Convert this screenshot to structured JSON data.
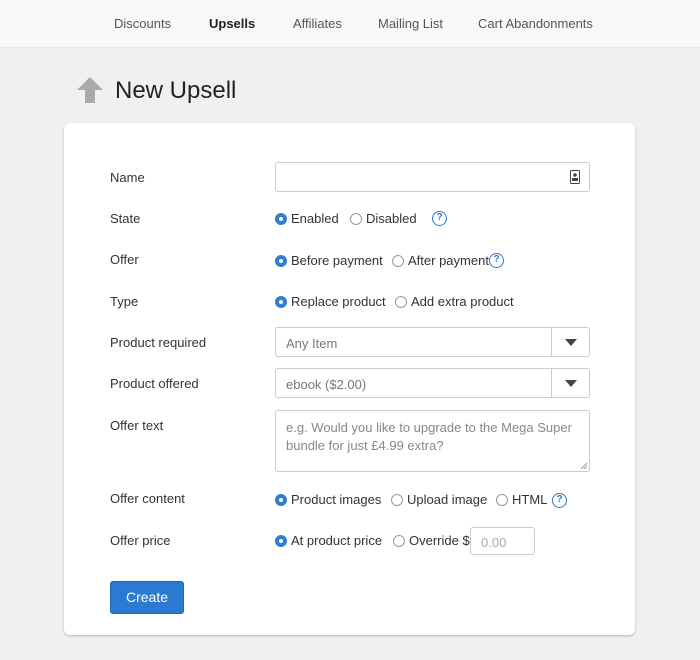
{
  "nav": {
    "items": [
      {
        "label": "Discounts",
        "active": false
      },
      {
        "label": "Upsells",
        "active": true
      },
      {
        "label": "Affiliates",
        "active": false
      },
      {
        "label": "Mailing List",
        "active": false
      },
      {
        "label": "Cart Abandonments",
        "active": false
      }
    ]
  },
  "page": {
    "title": "New Upsell",
    "icon": "arrow-up-icon"
  },
  "form": {
    "name": {
      "label": "Name",
      "value": "",
      "icon": "contact-card-icon"
    },
    "state": {
      "label": "State",
      "options": [
        {
          "label": "Enabled",
          "selected": true
        },
        {
          "label": "Disabled",
          "selected": false
        }
      ],
      "help": "?"
    },
    "offer": {
      "label": "Offer",
      "options": [
        {
          "label": "Before payment",
          "selected": true
        },
        {
          "label": "After payment",
          "selected": false
        }
      ],
      "help": "?"
    },
    "type": {
      "label": "Type",
      "options": [
        {
          "label": "Replace product",
          "selected": true
        },
        {
          "label": "Add extra product",
          "selected": false
        }
      ]
    },
    "product_required": {
      "label": "Product required",
      "value": "Any Item"
    },
    "product_offered": {
      "label": "Product offered",
      "value": "ebook ($2.00)"
    },
    "offer_text": {
      "label": "Offer text",
      "value": "",
      "placeholder": "e.g. Would you like to upgrade to the Mega Super bundle for just £4.99 extra?"
    },
    "offer_content": {
      "label": "Offer content",
      "options": [
        {
          "label": "Product images",
          "selected": true
        },
        {
          "label": "Upload image",
          "selected": false
        },
        {
          "label": "HTML",
          "selected": false
        }
      ],
      "help": "?"
    },
    "offer_price": {
      "label": "Offer price",
      "options": [
        {
          "label": "At product price",
          "selected": true
        },
        {
          "label": "Override $",
          "selected": false
        }
      ],
      "override_placeholder": "0.00"
    },
    "submit_label": "Create"
  },
  "colors": {
    "accent": "#2a7ad1",
    "background": "#f0f0f0",
    "card": "#ffffff"
  }
}
